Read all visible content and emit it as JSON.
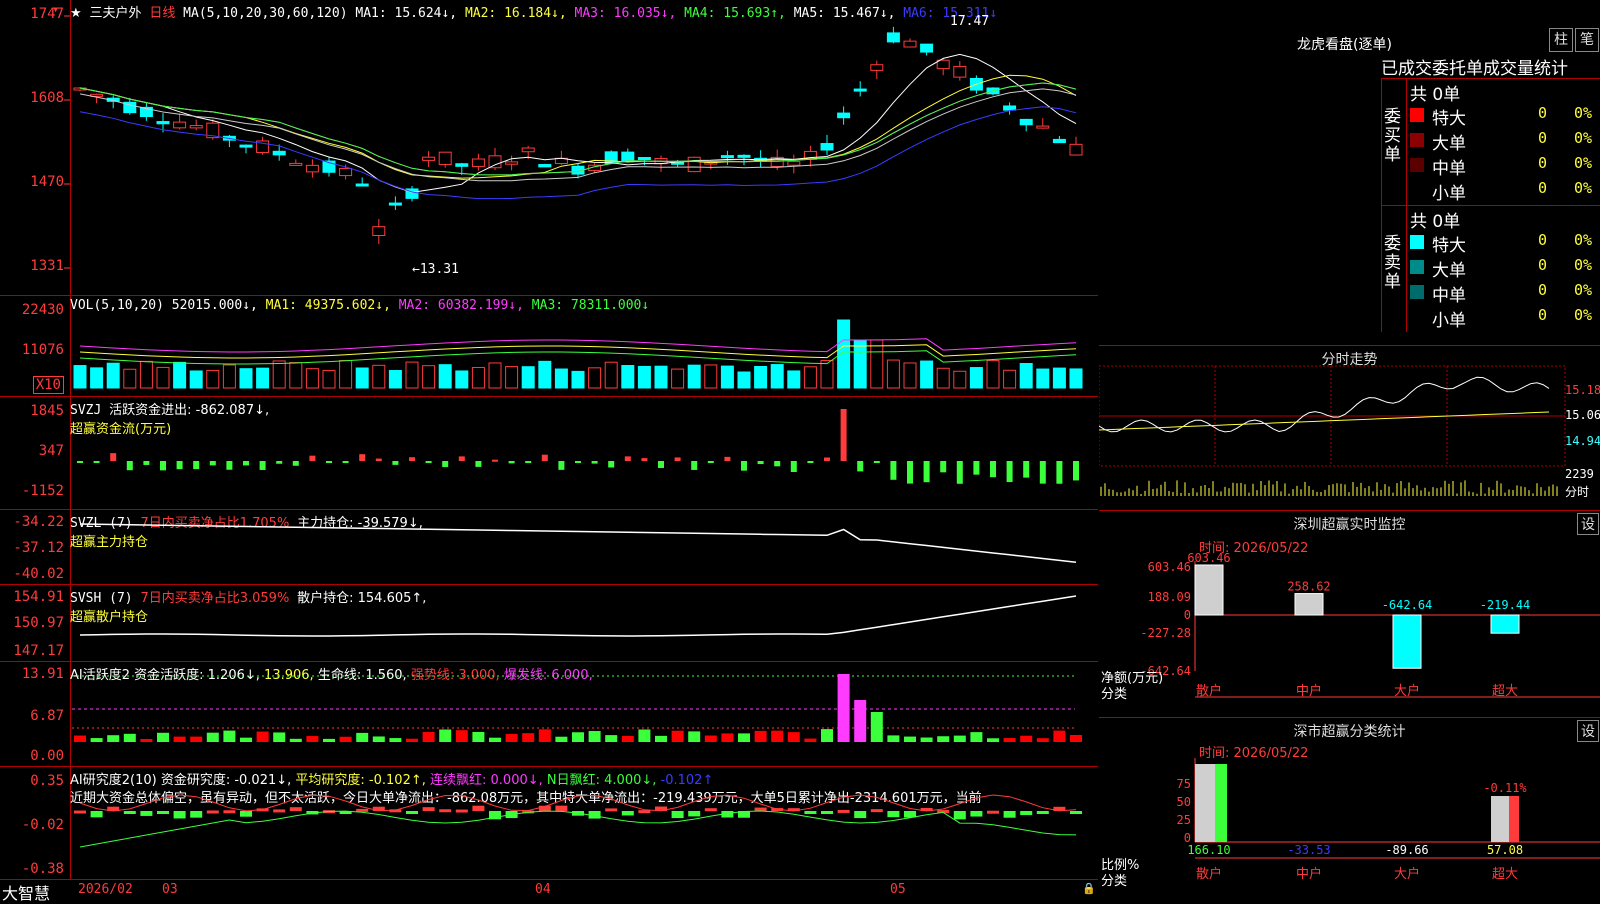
{
  "stock": {
    "name": "三夫户外",
    "period": "日线",
    "ma_params": "MA(5,10,20,30,60,120)",
    "ma1": "MA1: 15.624↓,",
    "ma2": "MA2: 16.184↓,",
    "ma3": "MA3: 16.035↓,",
    "ma4": "MA4: 15.693↑,",
    "ma5": "MA5: 15.467↓,",
    "ma6": "MA6: 15.311↓",
    "high_mark": "17.47",
    "low_mark": "←13.31",
    "price_axis": [
      "1747",
      "1608",
      "1470",
      "1331"
    ]
  },
  "vol": {
    "params": "VOL(5,10,20)",
    "value": "52015.000↓,",
    "ma1": "MA1: 49375.602↓,",
    "ma2": "MA2: 60382.199↓,",
    "ma3": "MA3: 78311.000↓",
    "axis": [
      "22430",
      "11076"
    ],
    "unit": "X10"
  },
  "svzj": {
    "title": "SVZJ",
    "label": "活跃资金进出: -862.087↓,",
    "sub": "超赢资金流(万元)",
    "axis": [
      "1845",
      "347",
      "-1152"
    ]
  },
  "svzl": {
    "title": "SVZL (7)",
    "pct": "7日内买卖净占比1.705%",
    "label": "主力持仓: -39.579↓,",
    "sub": "超赢主力持仓",
    "axis": [
      "-34.22",
      "-37.12",
      "-40.02"
    ]
  },
  "svsh": {
    "title": "SVSH (7)",
    "pct": "7日内买卖净占比3.059%",
    "label": "散户持仓: 154.605↑,",
    "sub": "超赢散户持仓",
    "axis": [
      "154.91",
      "150.97",
      "147.17"
    ]
  },
  "ai_active": {
    "title": "AI活跃度2",
    "label": "资金活跃度: 1.206↓,",
    "v2": "13.906,",
    "life": "生命线: 1.560,",
    "strong": "强势线: 3.000,",
    "burst": "爆发线: 6.000,",
    "axis": [
      "13.91",
      "6.87",
      "0.00"
    ]
  },
  "ai_research": {
    "title": "AI研究度2(10)",
    "label": "资金研究度: -0.021↓,",
    "avg": "平均研究度: -0.102↑,",
    "cont": "连续飘红: 0.000↓,",
    "nday": "N日飘红: 4.000↓,",
    "last": "-0.102↑",
    "text": "近期大资金总体偏空，虽有异动，但不太活跃，今日大单净流出：-862.08万元，其中特大单净流出：-219.439万元，大单5日累计净出-2314.601万元，当前",
    "axis": [
      "0.35",
      "-0.02",
      "-0.38"
    ]
  },
  "bottom_bar": {
    "brand": "大智慧",
    "dates": [
      "2026/02",
      "03",
      "04",
      "05"
    ]
  },
  "lhb": {
    "title": "龙虎看盘(逐单)",
    "btn1": "柱",
    "btn2": "笔",
    "tab": "已成交委托单成交量统计",
    "buy_label": "委买单",
    "sell_label": "委卖单",
    "buy_total": "共 0单",
    "sell_total": "共 0单",
    "buy_rows": [
      {
        "name": "特大",
        "val": "0",
        "pct": "0%",
        "color": "#ff0000"
      },
      {
        "name": "大单",
        "val": "0",
        "pct": "0%",
        "color": "#8b0000"
      },
      {
        "name": "中单",
        "val": "0",
        "pct": "0%",
        "color": "#5a0000"
      },
      {
        "name": "小单",
        "val": "0",
        "pct": "0%",
        "color": "#000000"
      }
    ],
    "sell_rows": [
      {
        "name": "特大",
        "val": "0",
        "pct": "0%",
        "color": "#00ffff"
      },
      {
        "name": "大单",
        "val": "0",
        "pct": "0%",
        "color": "#008b8b"
      },
      {
        "name": "中单",
        "val": "0",
        "pct": "0%",
        "color": "#006b6b"
      },
      {
        "name": "小单",
        "val": "0",
        "pct": "0%",
        "color": "#000000"
      }
    ]
  },
  "fenshi": {
    "title": "分时走势",
    "p1": "15.18",
    "p2": "15.06",
    "p3": "14.94",
    "vol": "2239",
    "vol_unit": "分时"
  },
  "monitor": {
    "title": "深圳超赢实时监控",
    "btn": "设",
    "time": "时间: 2026/05/22",
    "axis": [
      "603.46",
      "188.09",
      "0",
      "-227.28",
      "-642.64"
    ],
    "bars": [
      {
        "label": "603.46",
        "value": 603.46
      },
      {
        "label": "258.62",
        "value": 258.62
      },
      {
        "label": "-642.64",
        "value": -642.64
      },
      {
        "label": "-219.44",
        "value": -219.44
      }
    ],
    "yname": "净额(万元)",
    "xname": "分类",
    "cats": [
      "散户",
      "中户",
      "大户",
      "超大"
    ]
  },
  "classify": {
    "title": "深市超赢分类统计",
    "btn": "设",
    "time": "时间: 2026/05/22",
    "axis": [
      "75",
      "50",
      "25",
      "0"
    ],
    "top_label": "-0.11%",
    "yname": "比例%",
    "xname": "分类",
    "values": [
      "166.10",
      "-33.53",
      "-89.66",
      "57.08"
    ],
    "cats": [
      "散户",
      "中户",
      "大户",
      "超大"
    ]
  }
}
